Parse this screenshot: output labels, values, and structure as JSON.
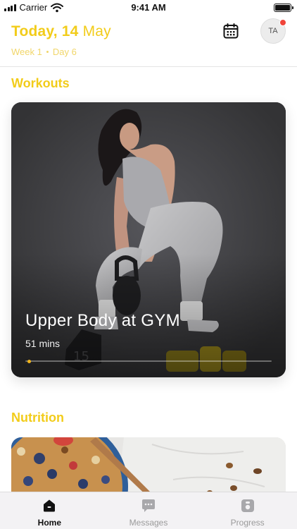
{
  "status_bar": {
    "carrier": "Carrier",
    "time": "9:41 AM"
  },
  "header": {
    "date_day": "Today, 14",
    "date_month": "May",
    "week": "Week 1",
    "day": "Day 6",
    "avatar_initials": "TA"
  },
  "workouts": {
    "title": "Workouts",
    "card": {
      "name": "Upper Body at GYM",
      "duration_value": "51",
      "duration_unit": "mins",
      "progress": 0.01
    }
  },
  "nutrition": {
    "title": "Nutrition"
  },
  "tab_bar": {
    "tabs": [
      {
        "label": "Home",
        "icon": "home-icon",
        "active": true
      },
      {
        "label": "Messages",
        "icon": "messages-icon",
        "active": false
      },
      {
        "label": "Progress",
        "icon": "progress-icon",
        "active": false
      }
    ]
  },
  "colors": {
    "accent": "#f2cc1a",
    "notification": "#f0453a",
    "progress": "#f2b51a"
  }
}
